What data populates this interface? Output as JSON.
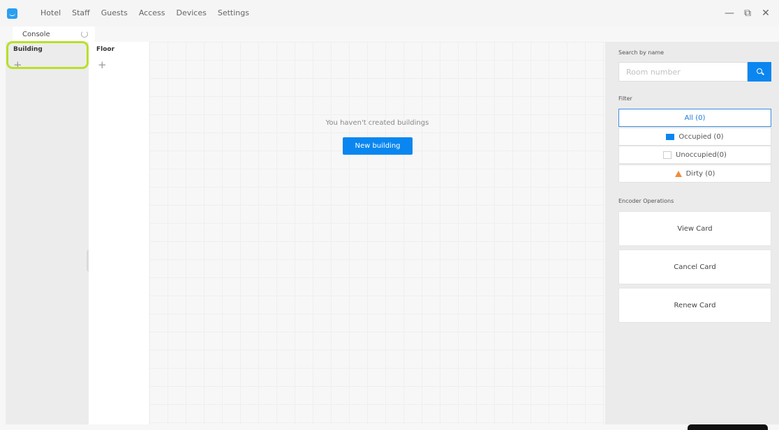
{
  "menu": {
    "items": [
      "Hotel",
      "Staff",
      "Guests",
      "Access",
      "Devices",
      "Settings"
    ]
  },
  "window_controls": {
    "minimize": "—",
    "restore": "⧉",
    "close": "✕"
  },
  "tabs": {
    "console_label": "Console"
  },
  "building_panel": {
    "title": "Building",
    "add": "+"
  },
  "floor_panel": {
    "title": "Floor",
    "add": "+"
  },
  "main": {
    "empty_message": "You haven't created buildings",
    "new_building_label": "New building"
  },
  "right_panel": {
    "search_label": "Search by name",
    "search_placeholder": "Room number",
    "filter_label": "Filter",
    "filters": {
      "all": "All (0)",
      "occupied": "Occupied (0)",
      "unoccupied": "Unoccupied(0)",
      "dirty": "Dirty (0)"
    },
    "encoder_label": "Encoder Operations",
    "view_card": "View Card",
    "cancel_card": "Cancel Card",
    "renew_card": "Renew Card"
  },
  "colors": {
    "accent": "#0a86f0",
    "highlight": "#b7e02a",
    "dirty": "#f08c3a"
  },
  "icons": {
    "logo": "app-logo-icon",
    "refresh": "refresh-icon",
    "search": "search-icon",
    "collapse": "chevron-left-icon"
  }
}
